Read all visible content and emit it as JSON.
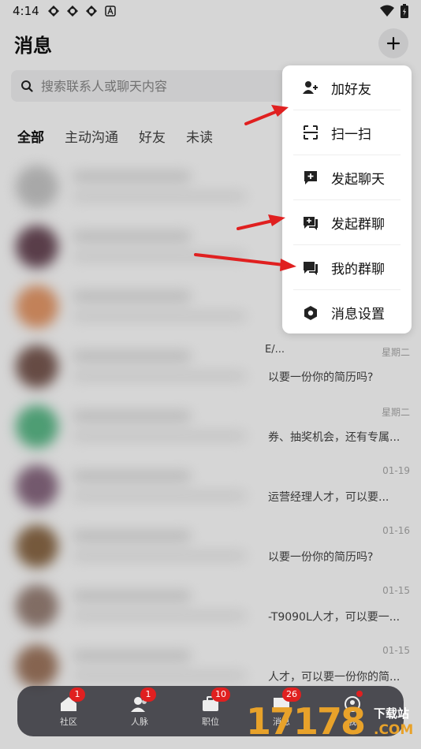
{
  "status_bar": {
    "time": "4:14"
  },
  "header": {
    "title": "消息"
  },
  "search": {
    "placeholder": "搜索联系人或聊天内容"
  },
  "tabs": [
    {
      "label": "全部",
      "active": true
    },
    {
      "label": "主动沟通",
      "active": false
    },
    {
      "label": "好友",
      "active": false
    },
    {
      "label": "未读",
      "active": false
    }
  ],
  "chats": [
    {
      "time": "",
      "snippet": "",
      "preview": "",
      "avatar_color": "#c9c9c9"
    },
    {
      "time": "",
      "snippet": "",
      "preview": "",
      "avatar_color": "#6b4a58"
    },
    {
      "time": "",
      "snippet": "",
      "preview": "",
      "avatar_color": "#e79a6a"
    },
    {
      "time": "星期二",
      "snippet": "E/...",
      "preview": "以要一份你的简历吗?",
      "avatar_color": "#7a5a52"
    },
    {
      "time": "星期二",
      "snippet": "",
      "preview": "券、抽奖机会，还有专属...",
      "avatar_color": "#5dbb8a"
    },
    {
      "time": "01-19",
      "snippet": "",
      "preview": "运营经理人才，可以要...",
      "avatar_color": "#8a6a82"
    },
    {
      "time": "01-16",
      "snippet": "",
      "preview": "以要一份你的简历吗?",
      "avatar_color": "#8c6a48"
    },
    {
      "time": "01-15",
      "snippet": "",
      "preview": "-T9090L人才，可以要一...",
      "avatar_color": "#9a8278"
    },
    {
      "time": "01-15",
      "snippet": "",
      "preview": "人才，可以要一份你的简...",
      "avatar_color": "#a07860"
    }
  ],
  "menu": {
    "items": [
      {
        "label": "加好友",
        "icon": "add-friend-icon"
      },
      {
        "label": "扫一扫",
        "icon": "scan-icon"
      },
      {
        "label": "发起聊天",
        "icon": "start-chat-icon"
      },
      {
        "label": "发起群聊",
        "icon": "start-group-chat-icon"
      },
      {
        "label": "我的群聊",
        "icon": "my-groups-icon"
      },
      {
        "label": "消息设置",
        "icon": "message-settings-icon"
      }
    ]
  },
  "bottom_nav": [
    {
      "label": "社区",
      "badge": "1"
    },
    {
      "label": "人脉",
      "badge": "1"
    },
    {
      "label": "职位",
      "badge": "10"
    },
    {
      "label": "消息",
      "badge": "26"
    },
    {
      "label": "我",
      "badge": ""
    }
  ],
  "watermark": {
    "digits": "17178",
    "top": "下载站",
    "bottom": ".COM"
  },
  "colors": {
    "badge": "#e02020",
    "arrow": "#e02020",
    "watermark": "#e8a22a"
  }
}
